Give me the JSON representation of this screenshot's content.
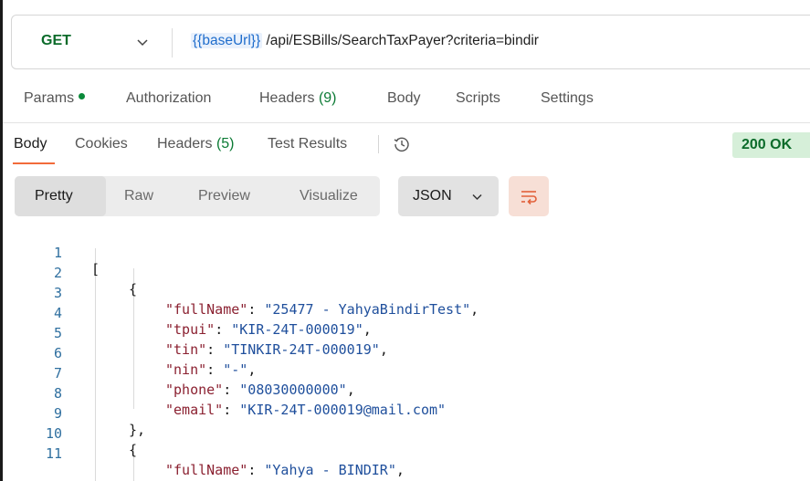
{
  "request": {
    "method": "GET",
    "url_var": "{{baseUrl}}",
    "url_path": "/api/ESBills/SearchTaxPayer?criteria=bindir"
  },
  "request_tabs": [
    {
      "label": "Params",
      "count": ""
    },
    {
      "label": "Authorization",
      "count": ""
    },
    {
      "label": "Headers",
      "count": "(9)"
    },
    {
      "label": "Body",
      "count": ""
    },
    {
      "label": "Scripts",
      "count": ""
    },
    {
      "label": "Settings",
      "count": ""
    }
  ],
  "response_tabs": [
    {
      "label": "Body",
      "count": ""
    },
    {
      "label": "Cookies",
      "count": ""
    },
    {
      "label": "Headers",
      "count": "(5)"
    },
    {
      "label": "Test Results",
      "count": ""
    }
  ],
  "status": "200 OK",
  "view_modes": [
    "Pretty",
    "Raw",
    "Preview",
    "Visualize"
  ],
  "format": "JSON",
  "icons": {
    "method_chevron": "chevron-down-icon",
    "history": "history-icon",
    "format_chevron": "chevron-down-icon",
    "wrap": "wrap-lines-icon"
  },
  "colors": {
    "method": "#0b6b2a",
    "accent": "#f26b3a",
    "status_bg": "#d6efd9",
    "json_key": "#8b2131",
    "json_string": "#1f4f9c"
  },
  "code_lines": [
    {
      "n": "1",
      "open": "[",
      "key": "",
      "sep": "",
      "val": "",
      "tail": ""
    },
    {
      "n": "2",
      "open": "{",
      "key": "",
      "sep": "",
      "val": "",
      "tail": ""
    },
    {
      "n": "3",
      "open": "",
      "key": "\"fullName\"",
      "sep": ": ",
      "val": "\"25477 - YahyaBindirTest\"",
      "tail": ","
    },
    {
      "n": "4",
      "open": "",
      "key": "\"tpui\"",
      "sep": ": ",
      "val": "\"KIR-24T-000019\"",
      "tail": ","
    },
    {
      "n": "5",
      "open": "",
      "key": "\"tin\"",
      "sep": ": ",
      "val": "\"TINKIR-24T-000019\"",
      "tail": ","
    },
    {
      "n": "6",
      "open": "",
      "key": "\"nin\"",
      "sep": ": ",
      "val": "\"-\"",
      "tail": ","
    },
    {
      "n": "7",
      "open": "",
      "key": "\"phone\"",
      "sep": ": ",
      "val": "\"08030000000\"",
      "tail": ","
    },
    {
      "n": "8",
      "open": "",
      "key": "\"email\"",
      "sep": ": ",
      "val": "\"KIR-24T-000019@mail.com\"",
      "tail": ""
    },
    {
      "n": "9",
      "open": "},",
      "key": "",
      "sep": "",
      "val": "",
      "tail": ""
    },
    {
      "n": "10",
      "open": "{",
      "key": "",
      "sep": "",
      "val": "",
      "tail": ""
    },
    {
      "n": "11",
      "open": "",
      "key": "\"fullName\"",
      "sep": ": ",
      "val": "\"Yahya - BINDIR\"",
      "tail": ","
    }
  ]
}
